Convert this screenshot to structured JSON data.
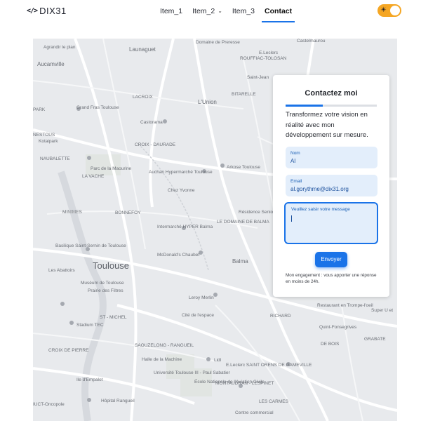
{
  "header": {
    "logo_icon": "</>",
    "logo_text": "DIX31",
    "nav": [
      {
        "label": "Item_1"
      },
      {
        "label": "Item_2",
        "chevron": "⌄"
      },
      {
        "label": "Item_3"
      },
      {
        "label": "Contact",
        "active": true
      }
    ],
    "theme_toggle": {
      "icon": "sun-icon",
      "glyph": "☀",
      "color": "#f5a623"
    }
  },
  "map": {
    "labels": {
      "toulouse": "Toulouse",
      "aucamville": "Aucamville",
      "launaguet": "Launaguet",
      "agrandir": "Agrandir le plan",
      "domaine_preresse": "Domaine de Preresse",
      "castelmaurou": "Castelmaurou",
      "eleclerc_rouffiac": "E.Leclerc",
      "rouffiac": "ROUFFIAC-TOLOSAN",
      "saint_jean": "Saint-Jean",
      "bitarelle": "BITARELLE",
      "lunion": "L'Union",
      "lacroix": "LACROIX",
      "grand_fras": "Grand Fras Toulouse",
      "park": "PARK",
      "castorama": "Castorama",
      "nestous": "NESTOUS",
      "kotaipark": "Kotaipark",
      "croix_daurade": "CROIX - DAURADE",
      "naubalette": "NAUBALETTE",
      "maourine": "Parc de la Maourine",
      "la_vache": "LA VACHE",
      "auchan": "Auchan Hypermarché Toulouse",
      "arkose": "Arkose Toulouse",
      "chez_yvonne": "Chez Yvonne",
      "minimes": "MINIMES",
      "bonnefoy": "BONNEFOY",
      "saint_sernin": "Basilique Saint-Sernin de Toulouse",
      "intermarche": "Intermarché HYPER Balma",
      "domaine_balma": "LE DOMAINE DE BALMA",
      "residence": "Résidence Seniors",
      "mcdo": "McDonald's Chaubet",
      "balma": "Balma",
      "abattoirs": "Les Abattoirs",
      "museum": "Muséum de Toulouse",
      "prairie": "Prairie des Filtres",
      "leroy": "Leroy Merlin",
      "st_michel": "ST - MICHEL",
      "cite_espace": "Cité de l'espace",
      "richard": "RICHARD",
      "restaurant": "Restaurant en Trompe-l'oeil",
      "super_u": "Super U et",
      "quint": "Quint-Fonsegrives",
      "grabate": "GRABATE",
      "stadium": "Stadium TEC",
      "rangueil": "SAOUZELONG - RANGUEIL",
      "croix_pierre": "CROIX DE PIERRE",
      "halle": "Halle de la Machine",
      "lidl": "Lidl",
      "eleclerc_orens": "E.Leclerc SAINT ORENS DE GAMEVILLE",
      "universite": "Université Toulouse III - Paul Sabatier",
      "ecole": "École Nationale de l'Aviation Civile",
      "montaudran": "MONTAUDRAN - LESPINET",
      "empalot": "Ile d'Empalot",
      "oncopole": "IUCT-Oncopole",
      "hopital": "Hôpital Rangueil",
      "carmes": "LES CARMES",
      "bois": "DE BOIS",
      "centre_com": "Centre commercial"
    }
  },
  "contact": {
    "title": "Contactez moi",
    "intro": "Transformez votre vision en réalité avec mon développement sur mesure.",
    "name_label": "Nom",
    "name_value": "Al",
    "email_label": "Email",
    "email_value": "al.gorythme@dix31.org",
    "message_placeholder": "Veuillez saisir votre message",
    "send_label": "Envoyer",
    "note": "Mon engagement : vous apporter une réponse en moins de 24h.",
    "accent": "#1a73e8"
  }
}
